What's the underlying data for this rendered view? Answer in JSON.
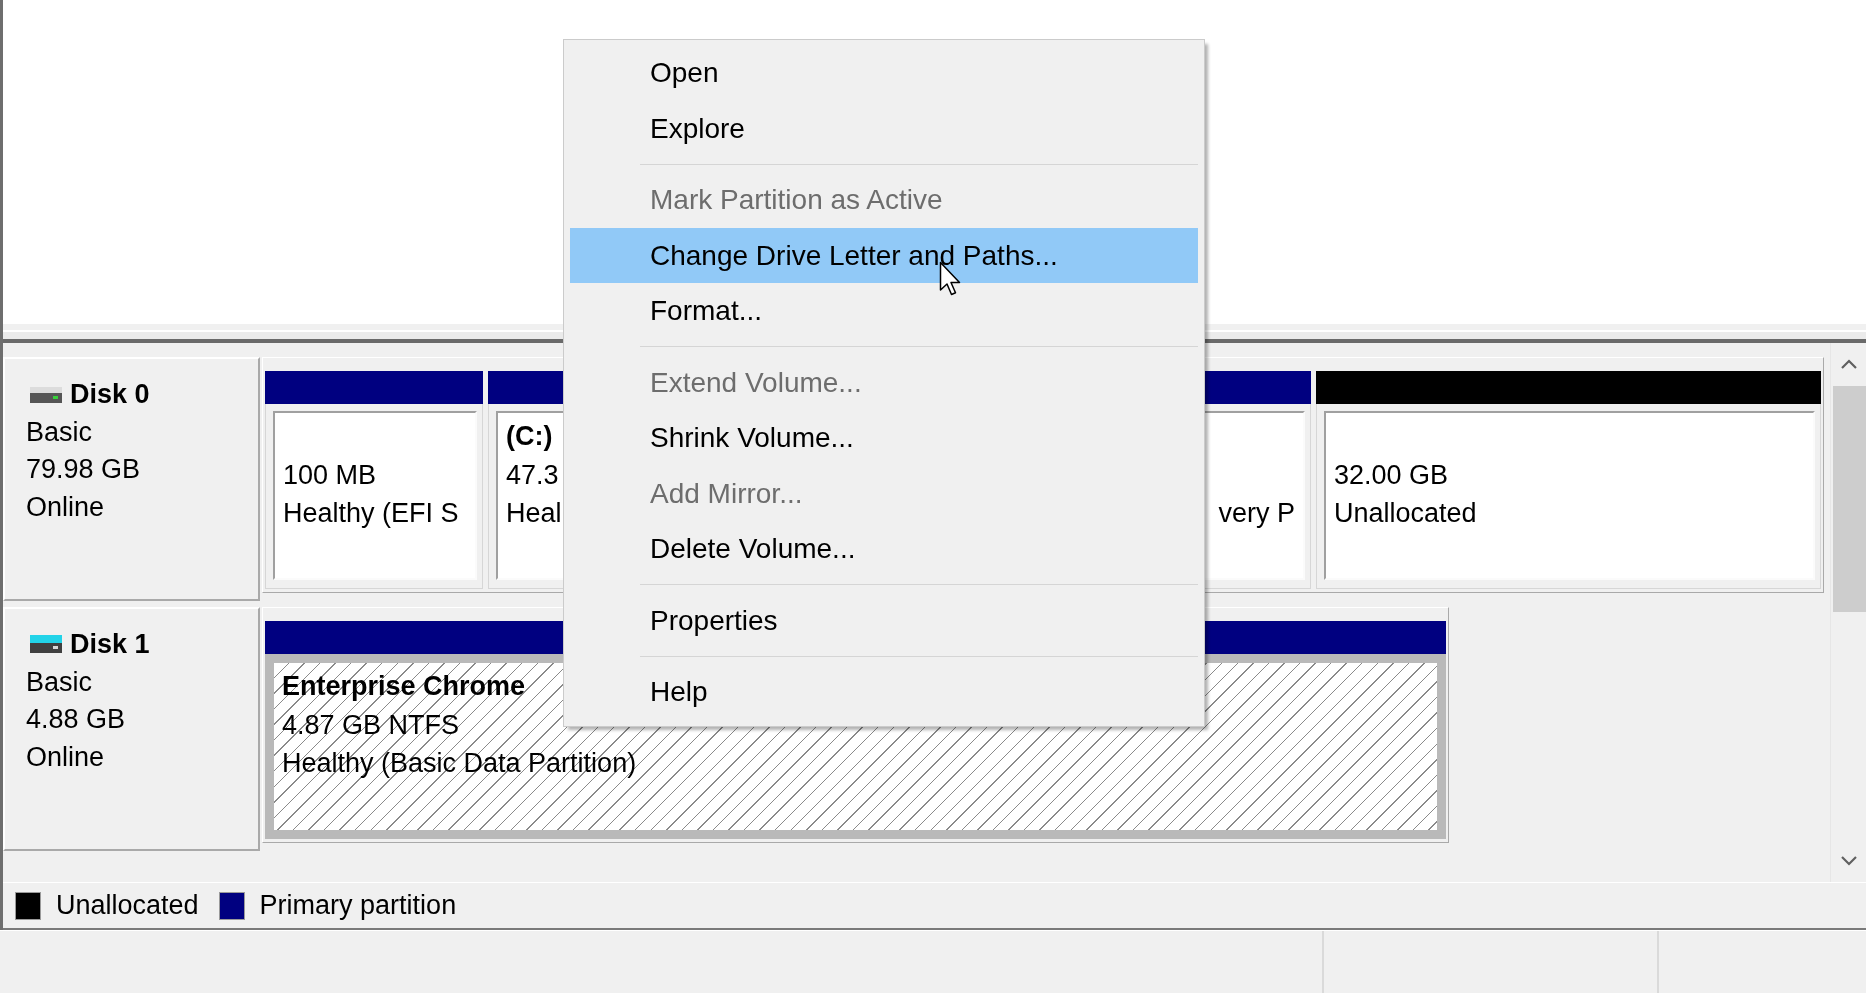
{
  "disks": [
    {
      "kind": "fixed",
      "name": "Disk 0",
      "type": "Basic",
      "size": "79.98 GB",
      "status": "Online",
      "partitions": [
        {
          "color": "#000080",
          "selected": false,
          "size": "100 MB",
          "status": "Healthy (EFI S"
        },
        {
          "color": "#000080",
          "selected": false,
          "name": "(C:)",
          "size": "47.3",
          "status": "Heal"
        },
        {
          "color": "#000080",
          "selected": false,
          "status": "very P"
        },
        {
          "color": "#000000",
          "selected": false,
          "size": "32.00 GB",
          "status": "Unallocated"
        }
      ]
    },
    {
      "kind": "removable",
      "name": "Disk 1",
      "type": "Basic",
      "size": "4.88 GB",
      "status": "Online",
      "partitions": [
        {
          "color": "#000080",
          "selected": true,
          "name": "Enterprise Chrome",
          "size": "4.87 GB NTFS",
          "status": "Healthy (Basic Data Partition)"
        }
      ]
    }
  ],
  "legend": [
    {
      "label": "Unallocated",
      "color": "#000000"
    },
    {
      "label": "Primary partition",
      "color": "#000080"
    }
  ],
  "context_menu": {
    "groups": [
      {
        "items": [
          {
            "label": "Open",
            "disabled": false,
            "selected": false
          },
          {
            "label": "Explore",
            "disabled": false,
            "selected": false
          }
        ]
      },
      {
        "items": [
          {
            "label": "Mark Partition as Active",
            "disabled": true,
            "selected": false
          },
          {
            "label": "Change Drive Letter and Paths...",
            "disabled": false,
            "selected": true
          },
          {
            "label": "Format...",
            "disabled": false,
            "selected": false
          }
        ]
      },
      {
        "items": [
          {
            "label": "Extend Volume...",
            "disabled": true,
            "selected": false
          },
          {
            "label": "Shrink Volume...",
            "disabled": false,
            "selected": false
          },
          {
            "label": "Add Mirror...",
            "disabled": true,
            "selected": false
          },
          {
            "label": "Delete Volume...",
            "disabled": false,
            "selected": false
          }
        ]
      },
      {
        "items": [
          {
            "label": "Properties",
            "disabled": false,
            "selected": false
          }
        ]
      },
      {
        "items": [
          {
            "label": "Help",
            "disabled": false,
            "selected": false
          }
        ]
      }
    ]
  }
}
